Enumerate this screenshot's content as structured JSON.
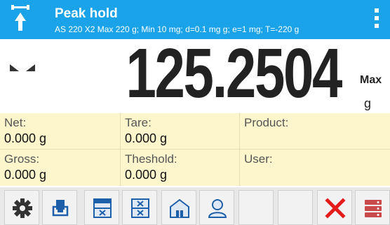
{
  "header": {
    "title": "Peak hold",
    "subtitle": "AS 220 X2   Max 220 g; Min 10 mg; d=0.1 mg g; e=1 mg; T=-220 g",
    "mode_icon": "peak-hold-icon",
    "menu_icon": "vertical-dots-icon",
    "bg_color": "#1aa3e8"
  },
  "display": {
    "weight": "125.2504",
    "max_label": "Max",
    "unit": "g",
    "stable_icon": "stability-indicator-icon"
  },
  "info": {
    "net_label": "Net:",
    "net_value": "0.000 g",
    "tare_label": "Tare:",
    "tare_value": "0.000 g",
    "product_label": "Product:",
    "product_value": "",
    "gross_label": "Gross:",
    "gross_value": "0.000 g",
    "threshold_label": "Theshold:",
    "threshold_value": "0.000 g",
    "user_label": "User:",
    "user_value": "",
    "bg_color": "#fdf6cc"
  },
  "toolbar": {
    "buttons": [
      "settings-icon",
      "printer-icon",
      "database-icon",
      "thresholds-icon",
      "warehouse-icon",
      "user-icon",
      "empty",
      "empty",
      "cancel-icon",
      "server-icon"
    ],
    "cancel_color": "#e31b1b"
  }
}
